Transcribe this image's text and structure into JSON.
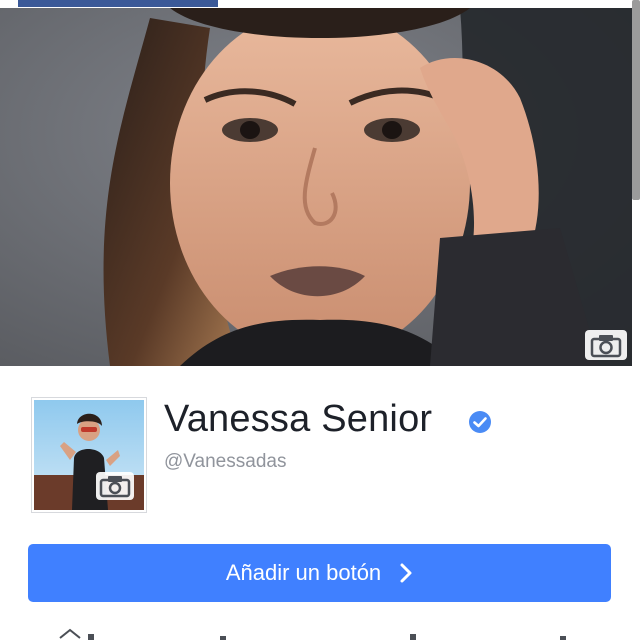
{
  "profile": {
    "name": "Vanessa Senior",
    "handle": "@Vanessadas",
    "verified": true
  },
  "cta": {
    "label": "Añadir un botón"
  },
  "colors": {
    "brand": "#3b5998",
    "button": "#4080ff",
    "verified": "#4a8bf5",
    "name_text": "#1d2129",
    "handle_text": "#90949c"
  },
  "icons": {
    "cover_camera": "camera-icon",
    "profile_camera": "camera-icon",
    "verified_badge": "verified-check-icon",
    "cta_chevron": "chevron-right-icon"
  }
}
